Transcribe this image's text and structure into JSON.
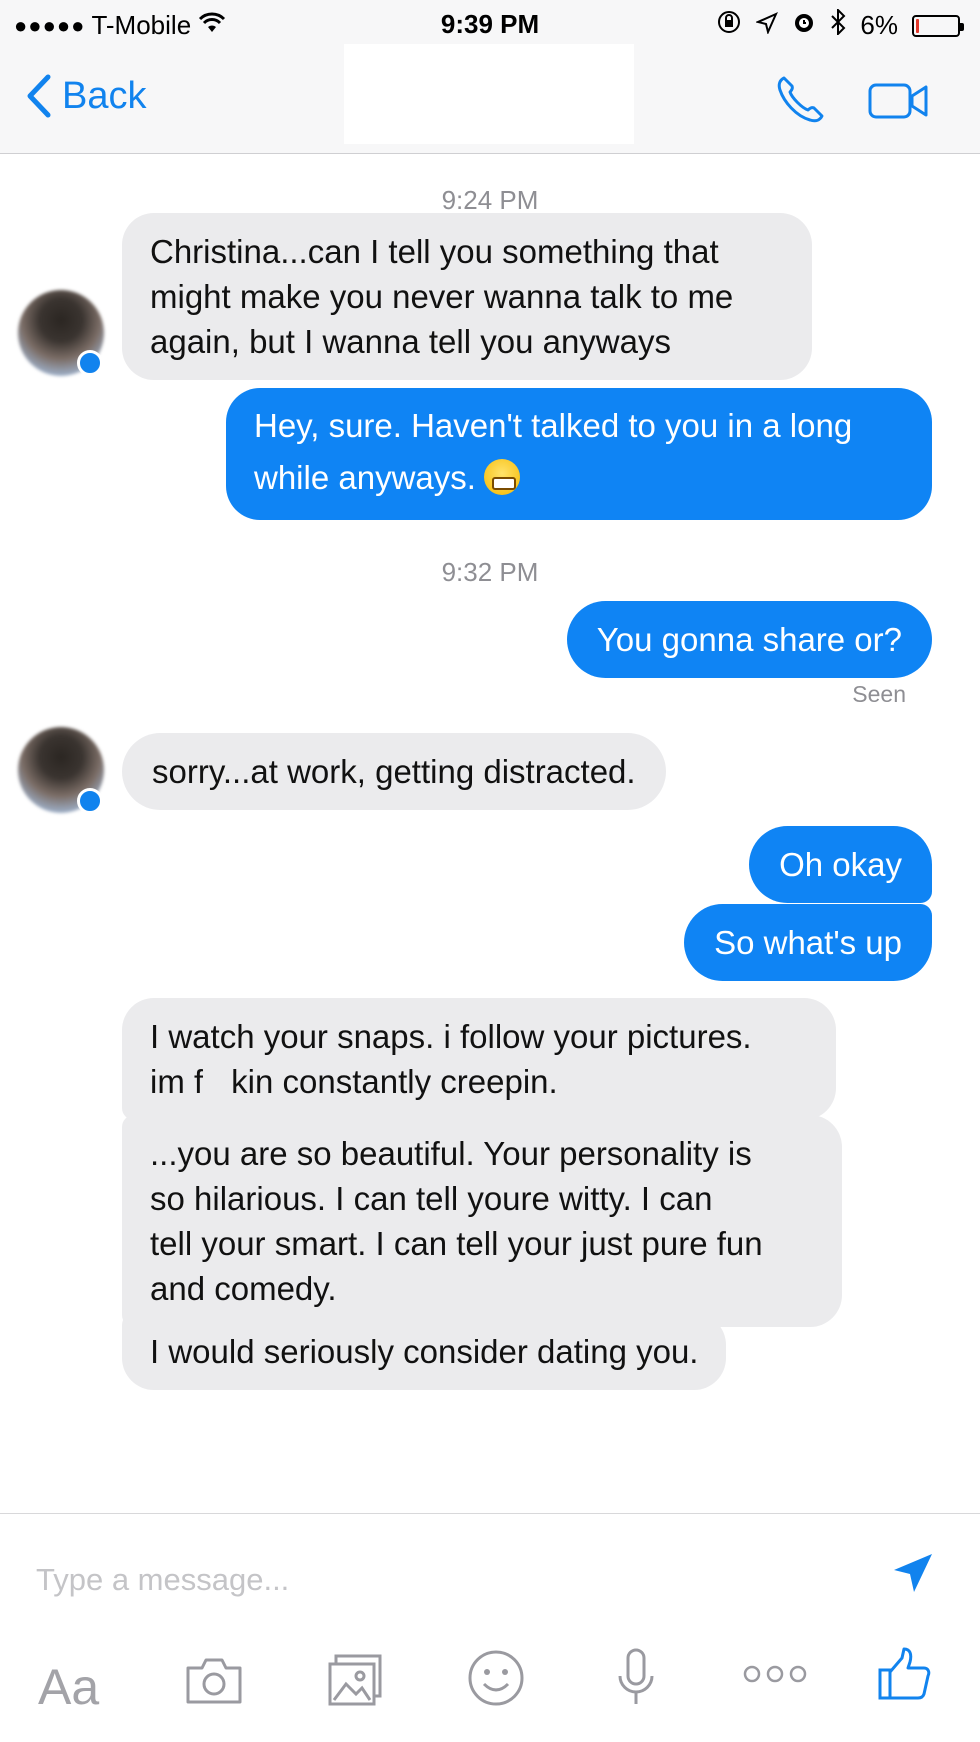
{
  "status": {
    "carrier": "T-Mobile",
    "time": "9:39 PM",
    "battery": "6%",
    "battery_level": 0.06
  },
  "nav": {
    "back_label": "Back"
  },
  "messages": {
    "ts1": "9:24 PM",
    "m1_line1": "Christina...can I tell you something that",
    "m1_line2": "might make you never wanna talk to me",
    "m1_line3": "again, but I wanna tell you anyways",
    "m2_line1": "Hey, sure. Haven't talked to you in a long",
    "m2_line2": "while anyways.",
    "ts2": "9:32 PM",
    "m3": "You gonna share or?",
    "seen": "Seen",
    "m4": "sorry...at work, getting distracted.",
    "m5": "Oh okay",
    "m6": "So what's up",
    "m7_line1": "I watch your snaps. i follow your pictures.",
    "m7_line2a": "im f",
    "m7_line2b": "kin constantly creepin.",
    "m8_line1": "...you are so beautiful. Your personality is",
    "m8_line2": "so hilarious. I can tell youre witty. I can",
    "m8_line3": "tell your smart. I can tell your just pure fun",
    "m8_line4": "and comedy.",
    "m9": "I would seriously consider dating you."
  },
  "input": {
    "placeholder": "Type a message..."
  },
  "toolbar": {
    "text_label": "Aa"
  },
  "colors": {
    "accent": "#1183ee",
    "outgoing_bubble": "#0f84f4",
    "incoming_bubble": "#ebebed",
    "timestamp": "#8e8e93"
  }
}
